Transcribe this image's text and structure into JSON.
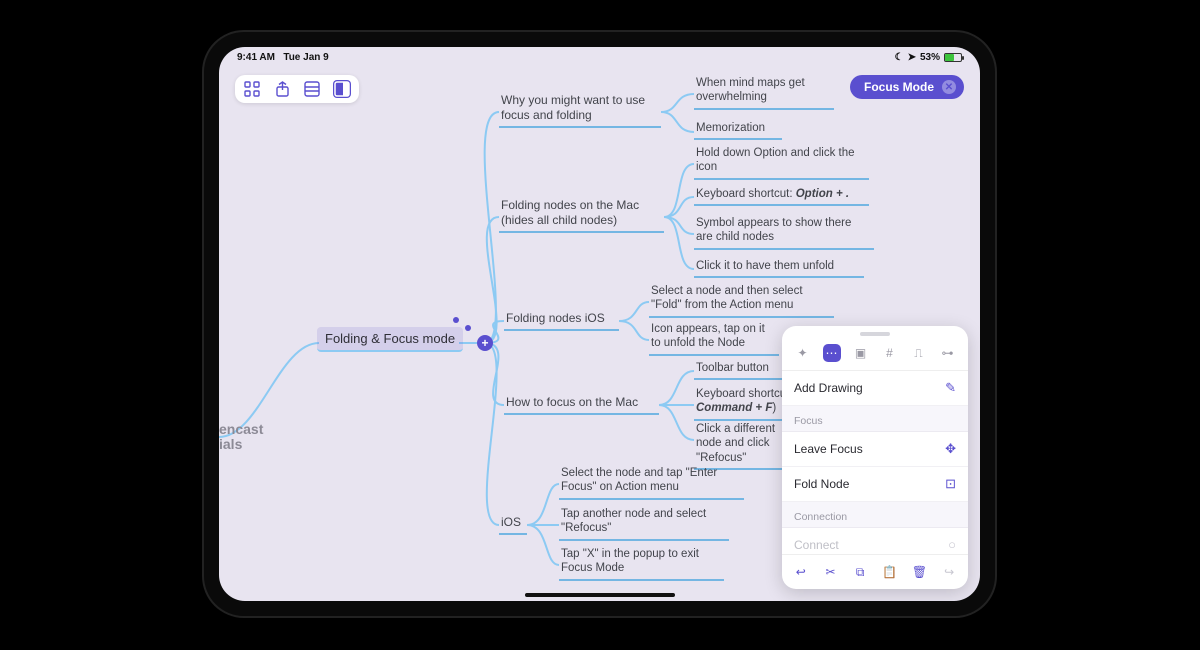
{
  "status": {
    "time": "9:41 AM",
    "date": "Tue Jan 9",
    "battery_pct": "53%"
  },
  "focus_pill": {
    "label": "Focus Mode"
  },
  "ghost": {
    "line1": "encast",
    "line2": "ials"
  },
  "root": {
    "label": "Folding & Focus mode"
  },
  "b1": {
    "label": "Why you might want to use focus and folding",
    "c1": "When mind maps get overwhelming",
    "c2": "Memorization"
  },
  "b2": {
    "label": "Folding nodes on the Mac (hides all child nodes)",
    "c1": "Hold down Option and click the icon",
    "c2_a": "Keyboard shortcut: ",
    "c2_b": "Option + .",
    "c3": "Symbol appears to show there are child nodes",
    "c4": "Click it to have them unfold"
  },
  "b3": {
    "label": "Folding nodes iOS",
    "c1": "Select a node and then select \"Fold\" from the Action menu",
    "c2": "Icon appears, tap on it to unfold the Node"
  },
  "b4": {
    "label": "How to focus on the Mac",
    "c1": "Toolbar button",
    "c2_a": "Keyboard shortcut: ",
    "c2_b": "Command + F",
    "c2_c": ")",
    "c3": "Click a different node and click \"Refocus\""
  },
  "b5": {
    "label": "iOS",
    "c1": "Select the node and tap \"Enter Focus\" on Action menu",
    "c2": "Tap another node and select \"Refocus\"",
    "c3": "Tap \"X\" in the popup to exit Focus Mode"
  },
  "panel": {
    "add_drawing": "Add Drawing",
    "section_focus": "Focus",
    "leave_focus": "Leave Focus",
    "fold_node": "Fold Node",
    "section_connection": "Connection",
    "connect": "Connect"
  }
}
